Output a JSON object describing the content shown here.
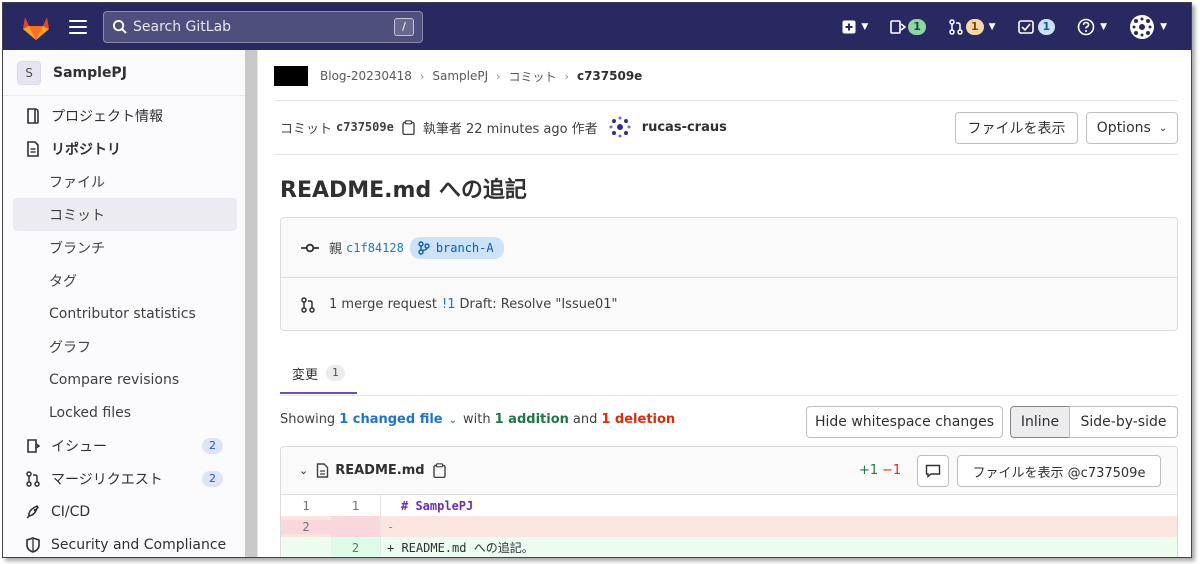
{
  "topbar": {
    "search_placeholder": "Search GitLab",
    "search_shortcut": "/",
    "mr_count": "1",
    "issues_count": "1",
    "todo_count": "1"
  },
  "sidebar": {
    "project_initial": "S",
    "project_name": "SamplePJ",
    "items": [
      {
        "label": "プロジェクト情報"
      },
      {
        "label": "リポジトリ"
      },
      {
        "label": "ファイル"
      },
      {
        "label": "コミット"
      },
      {
        "label": "ブランチ"
      },
      {
        "label": "タグ"
      },
      {
        "label": "Contributor statistics"
      },
      {
        "label": "グラフ"
      },
      {
        "label": "Compare revisions"
      },
      {
        "label": "Locked files"
      },
      {
        "label": "イシュー",
        "count": "2"
      },
      {
        "label": "マージリクエスト",
        "count": "2"
      },
      {
        "label": "CI/CD"
      },
      {
        "label": "Security and Compliance"
      }
    ]
  },
  "breadcrumb": {
    "items": [
      "Blog-20230418",
      "SamplePJ",
      "コミット",
      "c737509e"
    ]
  },
  "commit": {
    "label": "コミット",
    "sha": "c737509e",
    "authored_text": "執筆者 22 minutes ago 作者",
    "author": "rucas-craus",
    "browse_files": "ファイルを表示",
    "options": "Options",
    "title": "README.md への追記",
    "parent_label": "親",
    "parent_sha": "c1f84128",
    "branch": "branch-A",
    "mr_text_prefix": "1 merge request",
    "mr_ref": "!1",
    "mr_title": "Draft: Resolve \"Issue01\""
  },
  "tabs": {
    "changes_label": "変更",
    "changes_count": "1"
  },
  "diff_summary": {
    "showing": "Showing",
    "changed": "1 changed file",
    "with": "with",
    "additions": "1 addition",
    "and": "and",
    "deletions": "1 deletion",
    "hide_whitespace": "Hide whitespace changes",
    "inline": "Inline",
    "side_by_side": "Side-by-side"
  },
  "file": {
    "name": "README.md",
    "added": "+1",
    "removed": "−1",
    "view_file": "ファイルを表示 @c737509e",
    "lines": [
      {
        "old": "1",
        "new": "1",
        "type": "context",
        "text": "# SamplePJ"
      },
      {
        "old": "2",
        "new": "",
        "type": "del",
        "text": "-"
      },
      {
        "old": "",
        "new": "2",
        "type": "add",
        "text": "+ README.md への追記。"
      }
    ]
  },
  "colors": {
    "topbar": "#292961",
    "accent": "#6b4fbb",
    "link": "#1f75cb",
    "addition": "#217645",
    "deletion": "#dd2b0e"
  }
}
